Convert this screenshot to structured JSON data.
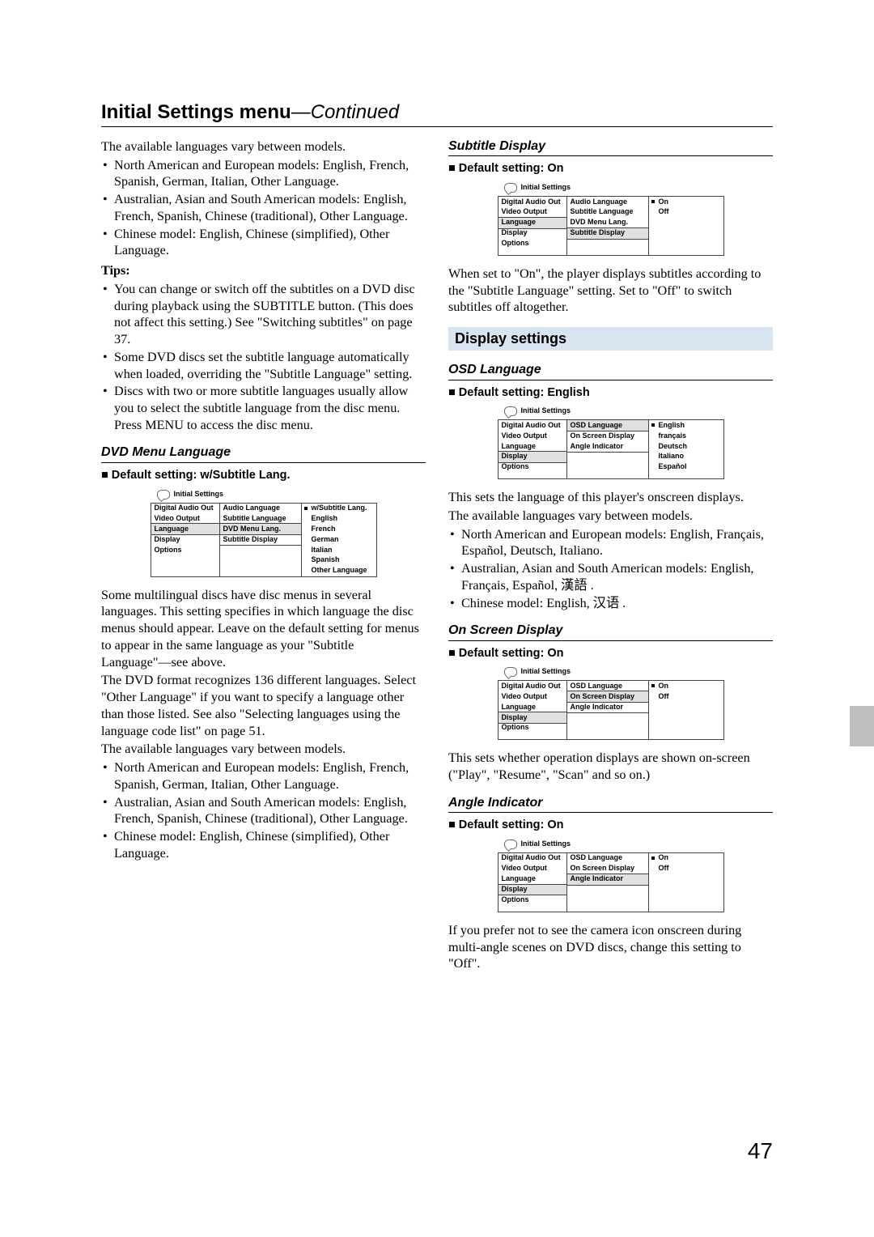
{
  "title_main": "Initial Settings menu",
  "title_cont": "—Continued",
  "left": {
    "intro": "The available languages vary between models.",
    "models": [
      "North American and European models: English, French, Spanish, German, Italian, Other Language.",
      "Australian, Asian and South American models: English, French, Spanish, Chinese (traditional), Other Language.",
      "Chinese model: English, Chinese (simplified), Other Language."
    ],
    "tips_label": "Tips:",
    "tips": [
      "You can change or switch off the subtitles on a DVD disc during playback using the SUBTITLE button. (This does not affect this setting.) See \"Switching subtitles\" on page 37.",
      "Some DVD discs set the subtitle language automatically when loaded, overriding the \"Subtitle Language\" setting.",
      "Discs with two or more subtitle languages usually allow you to select the subtitle language from the disc menu. Press MENU to access the disc menu."
    ],
    "dvdmenu_h": "DVD Menu Language",
    "dvdmenu_default": "Default setting: w/Subtitle Lang.",
    "dvdmenu_para1": "Some multilingual discs have disc menus in several languages. This setting specifies in which language the disc menus should appear. Leave on the default setting for menus to appear in the same language as your \"Subtitle Language\"—see above.",
    "dvdmenu_para2": "The DVD format recognizes 136 different languages. Select \"Other Language\" if you want to specify a language other than those listed. See also \"Selecting languages using the language code list\" on page 51.",
    "dvdmenu_para3": "The available languages vary between models.",
    "dvdmenu_models": [
      "North American and European models: English, French, Spanish, German, Italian, Other Language.",
      "Australian, Asian and South American models: English, French, Spanish, Chinese (traditional), Other Language.",
      "Chinese model: English, Chinese (simplified), Other Language."
    ]
  },
  "right": {
    "subdisp_h": "Subtitle Display",
    "subdisp_default": "Default setting: On",
    "subdisp_para": "When set to \"On\", the player displays subtitles according to the \"Subtitle Language\" setting. Set to \"Off\" to switch subtitles off altogether.",
    "section_h": "Display settings",
    "osd_h": "OSD Language",
    "osd_default": "Default setting: English",
    "osd_para1": "This sets the language of this player's onscreen displays.",
    "osd_para2": "The available languages vary between models.",
    "osd_models": [
      "North American and European models: English, Français, Español, Deutsch, Italiano.",
      "Australian, Asian and South American models: English, Français, Español, 漢語 .",
      "Chinese model: English, 汉语 ."
    ],
    "onscreen_h": "On Screen Display",
    "onscreen_default": "Default setting: On",
    "onscreen_para": "This sets whether operation displays are shown on-screen (\"Play\", \"Resume\", \"Scan\" and so on.)",
    "angle_h": "Angle Indicator",
    "angle_default": "Default setting: On",
    "angle_para": "If you prefer not to see the camera icon onscreen during multi-angle scenes on DVD discs, change this setting to \"Off\"."
  },
  "screens": {
    "head": "Initial Settings",
    "col1_base": [
      "Digital Audio Out",
      "Video Output",
      "Language",
      "Display",
      "Options"
    ],
    "lang_col2": [
      "Audio Language",
      "Subtitle Language",
      "DVD Menu Lang.",
      "Subtitle Display"
    ],
    "dvdmenu_opts": [
      "w/Subtitle Lang.",
      "English",
      "French",
      "German",
      "Italian",
      "Spanish",
      "Other Language"
    ],
    "subdisp_opts": [
      "On",
      "Off"
    ],
    "disp_col2": [
      "OSD Language",
      "On Screen Display",
      "Angle Indicator"
    ],
    "osd_opts": [
      "English",
      "français",
      "Deutsch",
      "Italiano",
      "Español"
    ],
    "onoff_opts": [
      "On",
      "Off"
    ]
  },
  "page_number": "47"
}
